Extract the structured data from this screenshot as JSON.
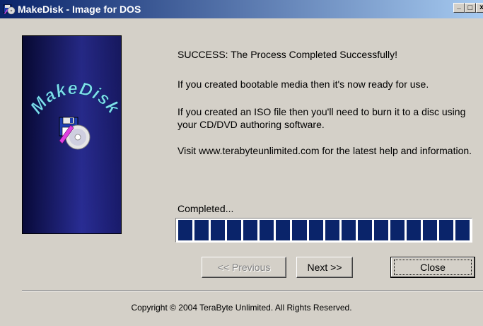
{
  "window": {
    "title": "MakeDisk - Image for DOS",
    "minimize_glyph": "_",
    "maximize_glyph": "□",
    "close_glyph": "x"
  },
  "side_panel": {
    "logo_text": "MakeDisk",
    "colors": {
      "dark": "#080a3a",
      "mid": "#2b2f9a",
      "logo_text": "#7fe0e8"
    }
  },
  "messages": {
    "success": "SUCCESS: The Process Completed Successfully!",
    "bootable": "If you created bootable media then it's now ready for use.",
    "iso": "If you created an ISO file then you'll need to burn it to a disc using your CD/DVD authoring software.",
    "visit": "Visit www.terabyteunlimited.com for the latest help and information."
  },
  "progress": {
    "label": "Completed...",
    "value_percent": 100,
    "segments": 18,
    "color": "#0a246a"
  },
  "buttons": {
    "previous_label": "<< Previous",
    "next_label": "Next >>",
    "close_label": "Close"
  },
  "footer": {
    "copyright": "Copyright © 2004 TeraByte Unlimited.  All Rights Reserved."
  }
}
